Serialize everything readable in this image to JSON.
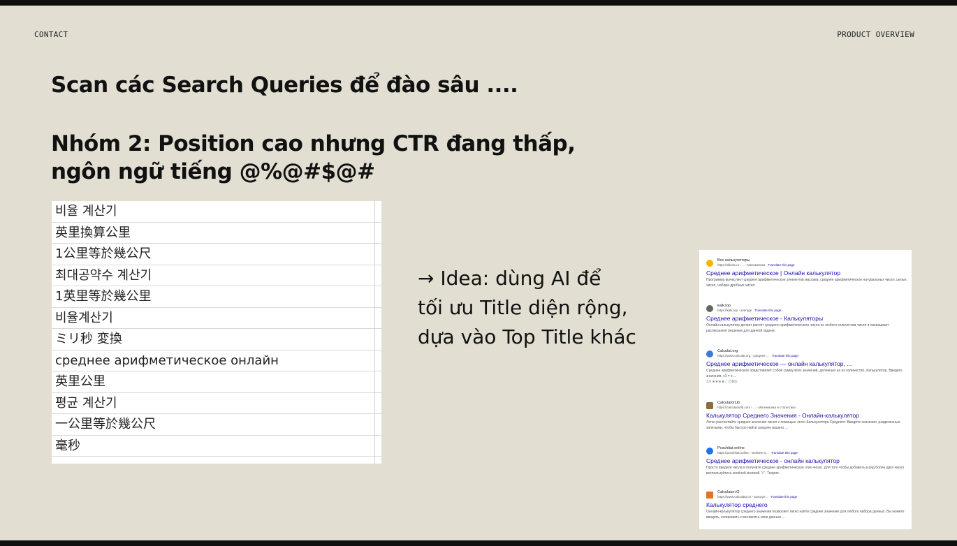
{
  "header": {
    "left": "CONTACT",
    "right": "PRODUCT OVERVIEW"
  },
  "title": "Scan các Search Queries để đào sâu ....",
  "subtitle": {
    "line1": "Nhóm 2: Position cao nhưng CTR đang thấp,",
    "line2": "ngôn ngữ tiếng @%@#$@#"
  },
  "queries": [
    "비율 계산기",
    "英里換算公里",
    "1公里等於幾公尺",
    "최대공약수 계산기",
    "1英里等於幾公里",
    "비율계산기",
    "ミリ秒 変換",
    "среднее арифметическое онлайн",
    "英里公里",
    "평균 계산기",
    "一公里等於幾公尺",
    "毫秒"
  ],
  "idea": {
    "line1": "→ Idea: dùng AI để",
    "line2": "tối ưu Title diện rộng,",
    "line3": "dựa vào Top Title khác"
  },
  "serp": [
    {
      "site": "Все калькуляторы",
      "url": "https://allcalc.ru › ... › Математика",
      "translate": "Translate this page",
      "title": "Среднее арифметическое | Онлайн калькулятор",
      "snippet": "Программа вычисляет среднее арифметическое элементов массива, среднее арифметическое натуральных чисел, целых чисел, набора дробных чисел.",
      "rating": "",
      "icon_color": "#f6b400"
    },
    {
      "site": "kalk.top",
      "url": "https://kalk.top › average",
      "translate": "Translate this page",
      "title": "Среднее арифметическое - Калькуляторы",
      "snippet": "Онлайн калькулятор делает расчёт среднего арифметического числа из любого количества чисел и показывает расписанное решение для данной задачи.",
      "rating": "",
      "icon_color": "#5f6b5f"
    },
    {
      "site": "Calculat.org",
      "url": "https://www.calculat.org › среднее-...",
      "translate": "Translate this page",
      "title": "Среднее арифметическое — онлайн калькулятор, ...",
      "snippet": "Среднее арифметическое представляет собой сумму всех значений, деленную на их количество. Калькулятор. Введите значения. x1 = x ...",
      "rating": "3.9 ★★★★☆ (160)",
      "icon_color": "#3b7bd4"
    },
    {
      "site": "CalculatorLib",
      "url": "https://calculatorlib.com › ... › Математика и статистика",
      "translate": "",
      "title": "Калькулятор Среднего Значения - Онлайн-калькулятор",
      "snippet": "Легко рассчитайте среднее значение чисел с помощью этого Калькулятора Среднего. Введите значения, разделенные запятыми, чтобы быстро найти среднее вашего ...",
      "rating": "",
      "icon_color": "#8a6d3b"
    },
    {
      "site": "Poschitat.online",
      "url": "https://poschitat.online › srednee-a...",
      "translate": "Translate this page",
      "title": "Среднее арифметическое - онлайн калькулятор",
      "snippet": "Просто введите числа и получите среднее арифметическое этих чисел. Для того чтобы добавить в ряд более двух чисел воспользуйтесь зелёной кнопкой \"+\". Теория.",
      "rating": "",
      "icon_color": "#1e73e8"
    },
    {
      "site": "Calculator.iO",
      "url": "https://www.calculator.io › калькул...",
      "translate": "Translate this page",
      "title": "Калькулятор среднего",
      "snippet": "Онлайн-калькулятор среднего значения позволяет легко найти среднее значение для любого набора данных. Вы можете вводить, копировать и вставлять свои данные ...",
      "rating": "",
      "icon_color": "#e8702a"
    }
  ]
}
